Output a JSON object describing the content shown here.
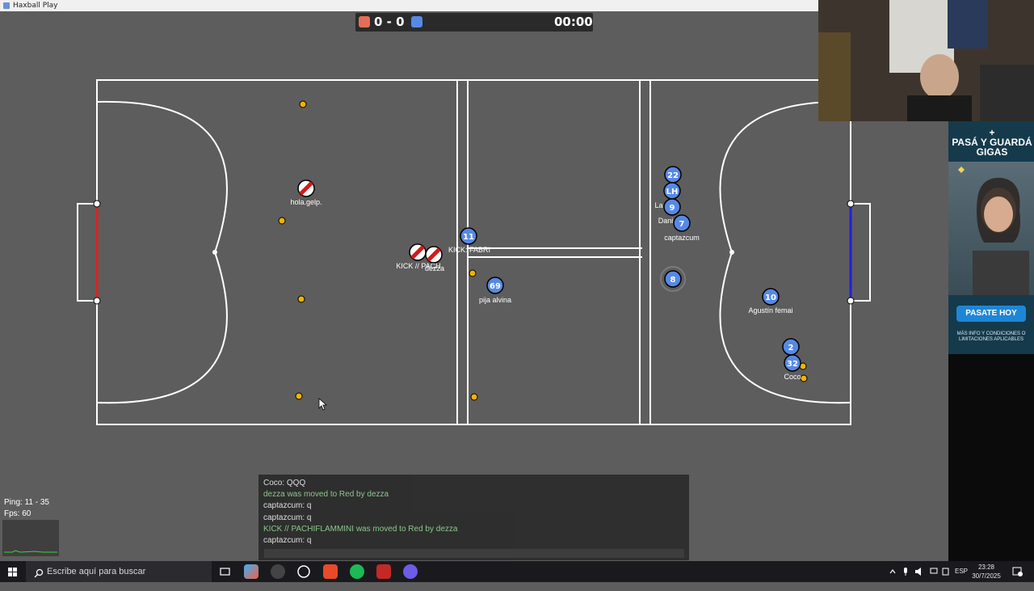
{
  "window": {
    "title": "Haxball Play"
  },
  "scoreboard": {
    "score": "0 - 0",
    "time": "00:00",
    "red_color": "#e56e56",
    "blue_color": "#5689e5"
  },
  "players": [
    {
      "team": "red",
      "avatar": "",
      "name": "hola.gelp."
    },
    {
      "team": "red",
      "avatar": "",
      "name": "KICK // PACH"
    },
    {
      "team": "red",
      "avatar": "",
      "name": "dezza"
    },
    {
      "team": "blue",
      "avatar": "11",
      "name": "KICK: FABRI"
    },
    {
      "team": "blue",
      "avatar": "69",
      "name": "pija alvina"
    },
    {
      "team": "blue",
      "avatar": "22",
      "name": ""
    },
    {
      "team": "blue",
      "avatar": "LH",
      "name": "La C"
    },
    {
      "team": "blue",
      "avatar": "9",
      "name": "Dani"
    },
    {
      "team": "blue",
      "avatar": "7",
      "name": "captazcum"
    },
    {
      "team": "ball",
      "avatar": "8",
      "name": ""
    },
    {
      "team": "blue",
      "avatar": "10",
      "name": "Agustín femai"
    },
    {
      "team": "blue",
      "avatar": "2",
      "name": ""
    },
    {
      "team": "blue",
      "avatar": "32",
      "name": "Coco"
    }
  ],
  "chat": {
    "messages": [
      {
        "text": "Coco: QQQ",
        "kind": "chat"
      },
      {
        "text": "dezza was moved to Red by dezza",
        "kind": "notice"
      },
      {
        "text": "captazcum: q",
        "kind": "chat"
      },
      {
        "text": "captazcum: q",
        "kind": "chat"
      },
      {
        "text": "KICK // PACHIFLAMMINI was moved to Red by dezza",
        "kind": "notice"
      },
      {
        "text": "captazcum: q",
        "kind": "chat"
      }
    ]
  },
  "stats": {
    "ping": "Ping: 11 - 35",
    "fps": "Fps: 60"
  },
  "ad": {
    "plus": "+",
    "title": "PASÁ Y GUARDÁ GIGAS",
    "button": "PASATE HOY",
    "fine_print": "MÁS INFO Y CONDICIONES O LIMITACIONES APLICABLES"
  },
  "taskbar": {
    "search_placeholder": "Escribe aquí para buscar",
    "language": "ESP",
    "time": "23:28",
    "date": "30/7/2025"
  },
  "field_colors": {
    "background": "#5d5d5d",
    "lines": "#ffffff",
    "red_goal": "#e02020",
    "blue_goal": "#2020e0",
    "cone": "#f0b400"
  }
}
